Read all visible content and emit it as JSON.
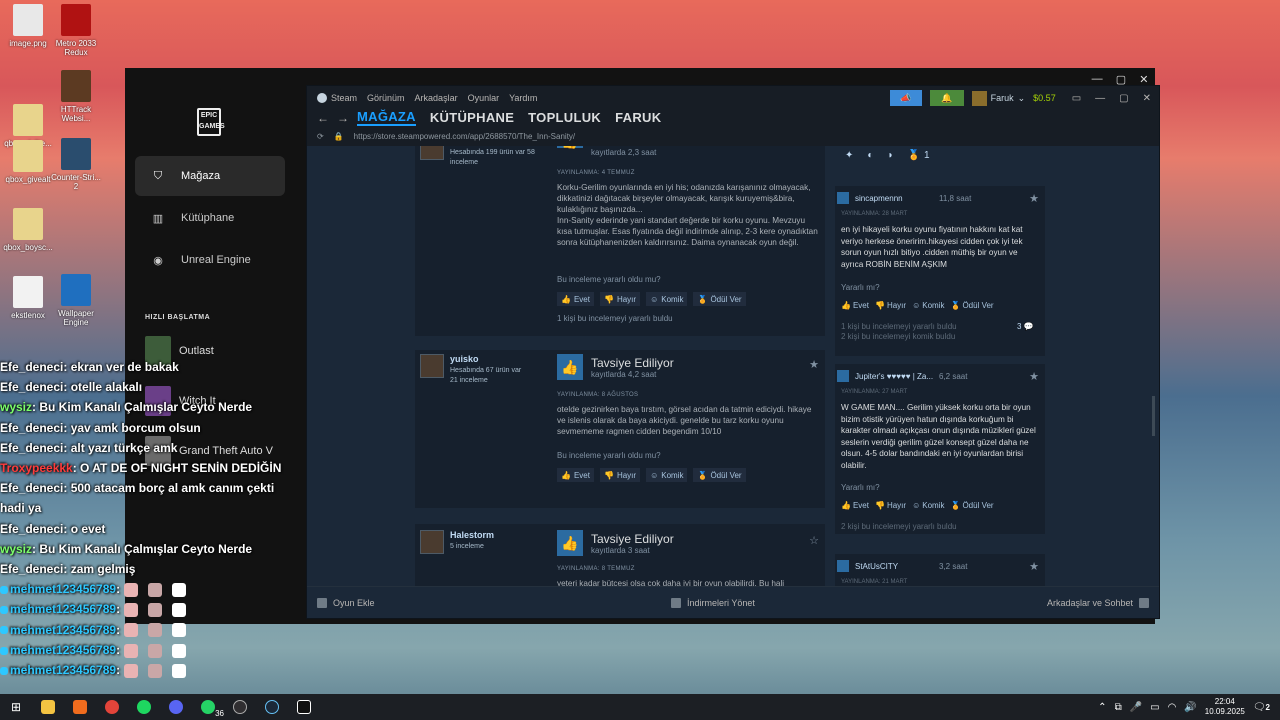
{
  "desktop": {
    "icons": [
      {
        "label": "image.png",
        "color": "#e8e8e8"
      },
      {
        "label": "Metro 2033 Redux",
        "color": "#b01212"
      },
      {
        "label": "qbox_dellte...",
        "color": "#e8d48c"
      },
      {
        "label": "HTTrack Websi...",
        "color": "#5c3a22"
      },
      {
        "label": "qbox_givealt",
        "color": "#e8d48c"
      },
      {
        "label": "Counter-Stri... 2",
        "color": "#2a4d6e"
      },
      {
        "label": "qbox_boysc...",
        "color": "#e8d48c"
      },
      {
        "label": "ekstlenox",
        "color": "#f2f2f2"
      },
      {
        "label": "Wallpaper Engine",
        "color": "#1f6fbf"
      }
    ]
  },
  "epic": {
    "logo_text": "EPIC GAMES",
    "window_controls": [
      "—",
      "▢",
      "✕"
    ],
    "nav": [
      {
        "label": "Mağaza",
        "icon": "tag"
      },
      {
        "label": "Kütüphane",
        "icon": "library"
      },
      {
        "label": "Unreal Engine",
        "icon": "unreal"
      }
    ],
    "quick_launch_heading": "HIZLI BAŞLATMA",
    "quick_launch": [
      {
        "label": "Outlast",
        "color": "#3d5c3a"
      },
      {
        "label": "Witch It",
        "color": "#6a3f88"
      },
      {
        "label": "Grand Theft Auto V",
        "color": "#6a6a6a"
      }
    ]
  },
  "steam": {
    "menu": [
      "Steam",
      "Görünüm",
      "Arkadaşlar",
      "Oyunlar",
      "Yardım"
    ],
    "user": {
      "name": "Faruk",
      "balance": "$0.57"
    },
    "tabs": [
      "MAĞAZA",
      "KÜTÜPHANE",
      "TOPLULUK",
      "FARUK"
    ],
    "url": "https://store.steampowered.com/app/2688570/The_Inn-Sanity/",
    "reviews": [
      {
        "name": "",
        "count": "Hesabında 199 ürün var\n58 inceleme",
        "hours": "kayıtlarda 2,3 saat",
        "posted": "YAYINLANMA: 4 TEMMUZ",
        "text": "Korku-Gerilim oyunlarında en iyi his; odanızda karışanınız olmayacak, dikkatinizi dağıtacak birşeyler olmayacak, karışık kuruyemiş&bira, kulaklığınız başınızda...\nInn-Sanity ederinde yani standart değerde bir korku oyunu. Mevzuyu kısa tutmuşlar. Esas fiyatında değil indirimde alınıp, 2-3 kere oynadıktan sonra kütüphanenizden kaldırırsınız. Daima oynanacak oyun değil.",
        "helpful_q": "Bu inceleme yararlı oldu mu?",
        "helped": "1 kişi bu incelemeyi yararlı buldu"
      },
      {
        "name": "yuisko",
        "count": "Hesabında 67 ürün var\n21 inceleme",
        "recommend": "Tavsiye Ediliyor",
        "hours": "kayıtlarda 4,2 saat",
        "posted": "YAYINLANMA: 8 AĞUSTOS",
        "text": "otelde gezinirken baya tırstım, görsel acıdan da tatmin ediciydi. hikaye ve islenis olarak da baya akiciydi. genelde bu tarz korku oyunu sevmememe ragmen cidden begendim 10/10",
        "helpful_q": "Bu inceleme yararlı oldu mu?"
      },
      {
        "name": "Halestorm",
        "count": "5 inceleme",
        "recommend": "Tavsiye Ediliyor",
        "hours": "kayıtlarda 3 saat",
        "posted": "YAYINLANMA: 8 TEMMUZ",
        "text": "yeteri kadar bütçesi olsa çok daha iyi bir oyun olabilirdi. Bu hali"
      }
    ],
    "vote_labels": {
      "yes": "Evet",
      "no": "Hayır",
      "funny": "Komik",
      "award": "Ödül Ver"
    },
    "badge_count": "1",
    "right_reviews": [
      {
        "name": "sincapmennn",
        "hours": "11,8 saat",
        "posted": "YAYINLANMA: 28 MART",
        "text": "en iyi hikayeli korku oyunu fiyatının hakkını kat kat veriyo herkese öneririm.hikayesi cidden çok iyi tek sorun oyun hızlı bitiyo .cidden müthiş bir oyun ve ayrıca ROBİN BENİM AŞKIM",
        "q": "Yararlı mı?",
        "stat1": "1 kişi bu incelemeyi yararlı buldu",
        "stat2": "2 kişi bu incelemeyi komik buldu",
        "comments": "3"
      },
      {
        "name": "Jupiter's ♥♥♥♥♥ | Za...",
        "hours": "6,2 saat",
        "posted": "YAYINLANMA: 27 MART",
        "text": "W GAME MAN.... Gerilim yüksek korku orta bir oyun bizim otistik yürüyen hatun dışında korkuğum bi karakter olmadı açıkçası onun dışında müzikleri güzel seslerin verdiği gerilim güzel konsept güzel daha ne olsun. 4-5 dolar bandındaki en iyi oyunlardan birisi olabilir.",
        "q": "Yararlı mı?",
        "stat1": "2 kişi bu incelemeyi yararlı buldu"
      },
      {
        "name": "StAtUsCITY",
        "hours": "3,2 saat",
        "posted": "YAYINLANMA: 21 MART"
      }
    ],
    "bottom": {
      "add_game": "Oyun Ekle",
      "downloads": "İndirmeleri Yönet",
      "friends": "Arkadaşlar ve Sohbet"
    }
  },
  "chat": [
    {
      "user": "Efe_deneci",
      "msg": ": ekran ver de bakak",
      "color": "white"
    },
    {
      "user": "Efe_deneci",
      "msg": ": otelle alakalı",
      "color": "white"
    },
    {
      "user": "wysiz",
      "msg": ": Bu Kim Kanalı Çalmışlar Ceyto Nerde",
      "color": "green"
    },
    {
      "user": "Efe_deneci",
      "msg": ": yav amk borcum olsun",
      "color": "white"
    },
    {
      "user": "Efe_deneci",
      "msg": ": alt yazı türkçe amk",
      "color": "white"
    },
    {
      "user": "Troxypeekkk",
      "msg": ": O AT DE OF NIGHT SENİN DEDİĞİN",
      "color": "red"
    },
    {
      "user": "Efe_deneci",
      "msg": ": 500 atacam borç al amk canım çekti",
      "color": "white"
    },
    {
      "user": "",
      "msg": "hadi ya",
      "color": "white"
    },
    {
      "user": "Efe_deneci",
      "msg": ": o evet",
      "color": "white"
    },
    {
      "user": "wysiz",
      "msg": ": Bu Kim Kanalı Çalmışlar Ceyto Nerde",
      "color": "green"
    },
    {
      "user": "Efe_deneci",
      "msg": ": zam gelmiş",
      "color": "white"
    },
    {
      "user": "mehmet123456789",
      "msg": ":",
      "color": "blue"
    },
    {
      "user": "mehmet123456789",
      "msg": ":",
      "color": "blue"
    },
    {
      "user": "mehmet123456789",
      "msg": ":",
      "color": "blue"
    },
    {
      "user": "mehmet123456789",
      "msg": ":",
      "color": "blue"
    },
    {
      "user": "mehmet123456789",
      "msg": ":",
      "color": "blue"
    }
  ],
  "taskbar": {
    "whatsapp_badge": "36",
    "time": "22:04",
    "date": "10.09.2025",
    "notif": "2"
  }
}
